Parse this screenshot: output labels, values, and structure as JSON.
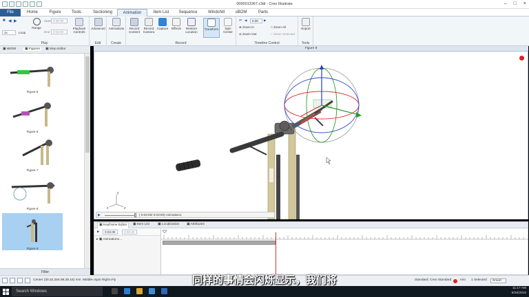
{
  "window": {
    "title": "0000013367.c3di - Creo Illustrate"
  },
  "tabs": [
    "File",
    "Home",
    "Figure",
    "Tools",
    "Sectioning",
    "Animation",
    "Item List",
    "Sequence",
    "Windchill",
    "sBOM",
    "Parts"
  ],
  "active_tab": "Animation",
  "ribbon": {
    "play": {
      "label": "Play",
      "speed": "1x",
      "loop": "Loop",
      "range": "Range",
      "start_label": "Start",
      "start_value": "0:00:00",
      "end_label": "End",
      "end_value": "0:03:00",
      "playback_controls": "Playback Controls"
    },
    "edit": {
      "label": "Edit",
      "advanced": "Advanced"
    },
    "create": {
      "label": "Create",
      "animations": "Animations"
    },
    "record": {
      "label": "Record",
      "record_content": "Record Content",
      "record_camera": "Record Camera",
      "capture": "Capture",
      "effects": "Effects",
      "restore_location": "Restore Location",
      "transform": "Transform",
      "spin_center": "Spin Center"
    },
    "timeline": {
      "label": "Timeline Control",
      "time_value": "0:00",
      "zoom_in": "Zoom In",
      "zoom_out": "Zoom Out",
      "zoom_all": "Zoom All",
      "zoom_selected": "Zoom Selected"
    },
    "tools": {
      "label": "Tools",
      "export": "Export"
    }
  },
  "left_panel": {
    "tabs": [
      "sBOM",
      "Figures",
      "Step Editor"
    ],
    "figures": [
      {
        "caption": "Figure 5"
      },
      {
        "caption": "Figure 6"
      },
      {
        "caption": "Figure 7"
      },
      {
        "caption": "Figure 8"
      },
      {
        "caption": "Figure 9",
        "selected": true
      }
    ],
    "filter_label": "Filter"
  },
  "viewport": {
    "title": "Figure 9",
    "playback_text": "( 0:03:00/ 0:03:00)  Animation1",
    "axis_labels": {
      "x": "x",
      "y": "y",
      "z": "z"
    }
  },
  "bottom_panel": {
    "tabs": [
      "Keyframe Editor",
      "Item List",
      "Localization",
      "Attributes"
    ],
    "active_tab": "Keyframe Editor",
    "time_box_1": "0:03.00",
    "time_box_2": "0:00.00",
    "animation_row": "Animation1..."
  },
  "status_bar": {
    "center": "Center (30.22,264.89,35.16) mm",
    "mouse": "Middle=Spin  Right=Fly",
    "standard": "Standard: Creo Standard",
    "units": "mm",
    "selection": "1 Selected",
    "mode": "Smart"
  },
  "subtitle": "同样的事情会闪烁显示，我们将",
  "taskbar": {
    "search_placeholder": "Search Windows",
    "time": "11:17 AM",
    "date": "9/28/2016"
  }
}
